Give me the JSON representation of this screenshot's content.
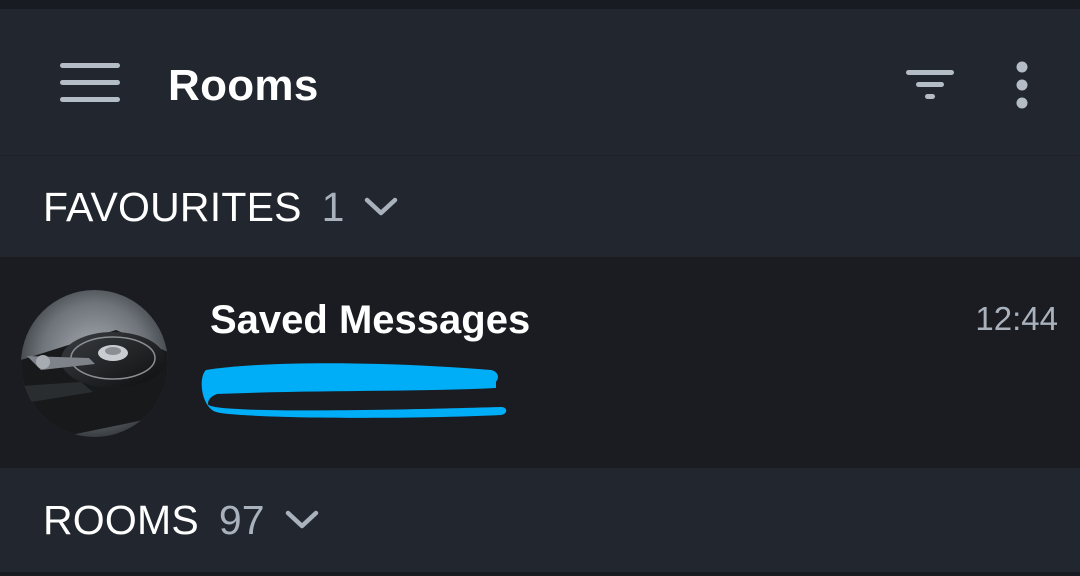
{
  "app_bar": {
    "title": "Rooms",
    "icons": {
      "menu": "hamburger-menu-icon",
      "filter": "filter-icon",
      "overflow": "more-vertical-icon"
    }
  },
  "sections": {
    "favourites": {
      "title": "FAVOURITES",
      "count": "1",
      "icon": "chevron-down-icon"
    },
    "rooms": {
      "title": "ROOMS",
      "count": "97",
      "icon": "chevron-down-icon"
    }
  },
  "favourite_rooms": [
    {
      "name": "Saved Messages",
      "time": "12:44",
      "preview_redacted": true
    }
  ],
  "colors": {
    "background": "#22262e",
    "row_background": "#1a1c22",
    "secondary_text": "#a9b2bc",
    "icon": "#b4bcc6",
    "redaction": "#00adf7"
  }
}
